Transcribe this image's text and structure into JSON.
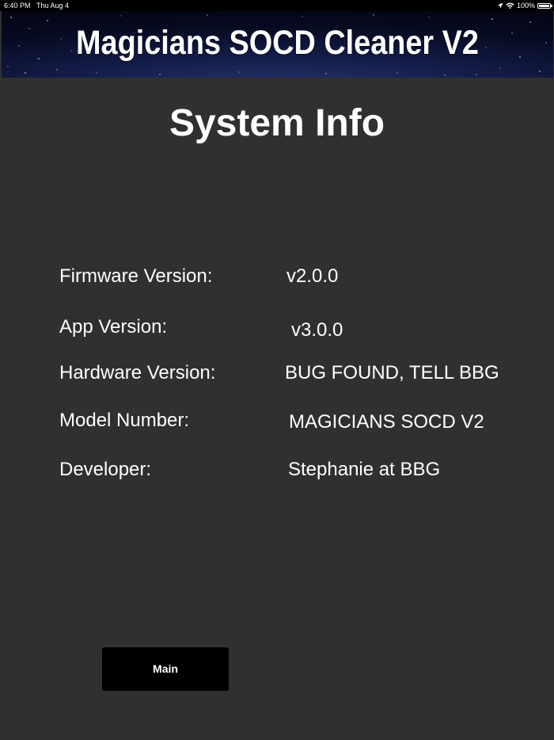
{
  "status_bar": {
    "time": "6:40 PM",
    "date": "Thu Aug 4",
    "battery": "100%",
    "icons": [
      "location-icon",
      "wifi-icon",
      "battery-icon"
    ]
  },
  "banner": {
    "title": "Magicians SOCD Cleaner V2"
  },
  "page": {
    "title": "System Info"
  },
  "info": [
    {
      "label": "Firmware Version:",
      "value": "v2.0.0"
    },
    {
      "label": "App Version:",
      "value": "v3.0.0"
    },
    {
      "label": "Hardware Version:",
      "value": "BUG FOUND, TELL BBG"
    },
    {
      "label": "Model Number:",
      "value": "MAGICIANS SOCD V2"
    },
    {
      "label": "Developer:",
      "value": "Stephanie at BBG"
    }
  ],
  "buttons": {
    "main_label": "Main"
  },
  "colors": {
    "background": "#303030",
    "status_bar": "#000000",
    "button": "#000000",
    "text": "#ffffff"
  }
}
